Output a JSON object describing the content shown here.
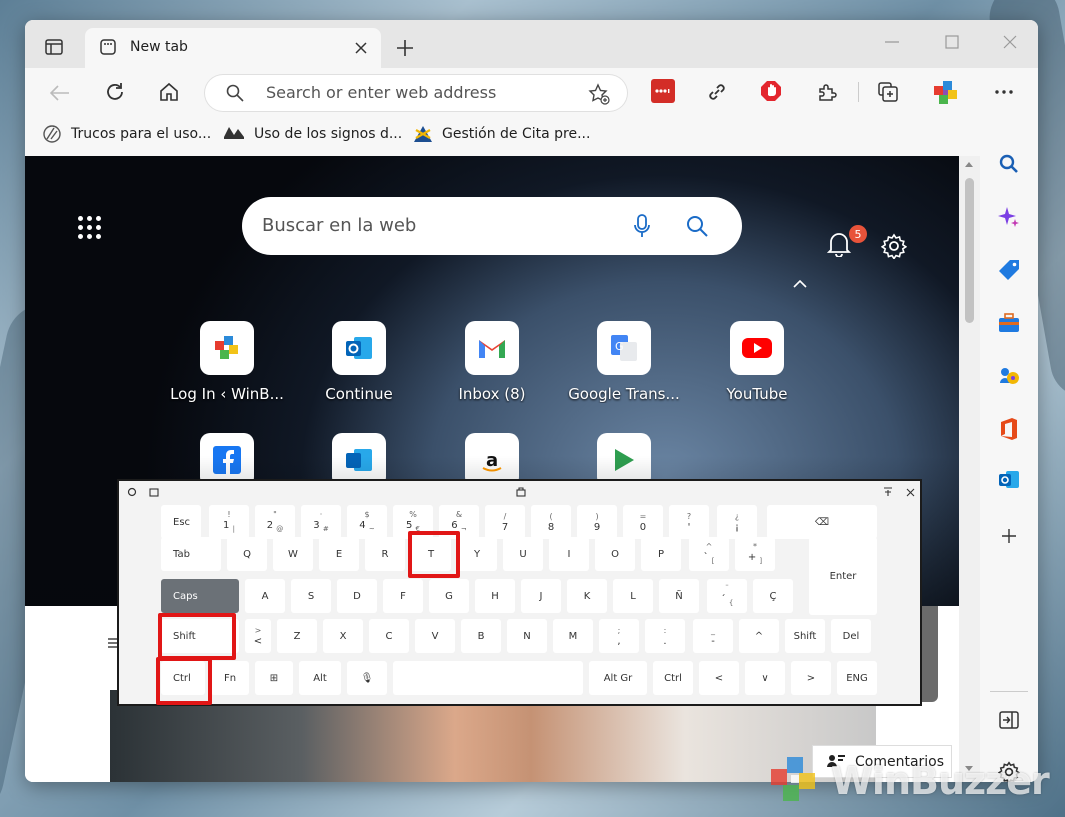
{
  "tab": {
    "title": "New tab"
  },
  "address_bar": {
    "placeholder": "Search or enter web address"
  },
  "favorites": [
    {
      "label": "Trucos para el uso..."
    },
    {
      "label": "Uso de los signos d..."
    },
    {
      "label": "Gestión de Cita pre..."
    }
  ],
  "newtab": {
    "search_placeholder": "Buscar en la web",
    "notification_count": "5",
    "tiles": [
      {
        "label": "Log In ‹ WinB..."
      },
      {
        "label": "Continue"
      },
      {
        "label": "Inbox (8)"
      },
      {
        "label": "Google Trans..."
      },
      {
        "label": "YouTube"
      }
    ],
    "feedback_label": "Comentarios"
  },
  "keyboard": {
    "rows": [
      [
        {
          "main": "Esc"
        },
        {
          "top": "!",
          "main": "1",
          "sub": "|"
        },
        {
          "top": "\"",
          "main": "2",
          "sub": "@"
        },
        {
          "top": "·",
          "main": "3",
          "sub": "#"
        },
        {
          "top": "$",
          "main": "4",
          "sub": "~"
        },
        {
          "top": "%",
          "main": "5",
          "sub": "€"
        },
        {
          "top": "&",
          "main": "6",
          "sub": "¬"
        },
        {
          "top": "/",
          "main": "7"
        },
        {
          "top": "(",
          "main": "8"
        },
        {
          "top": ")",
          "main": "9"
        },
        {
          "top": "=",
          "main": "0"
        },
        {
          "top": "?",
          "main": "'"
        },
        {
          "top": "¿",
          "main": "¡"
        }
      ],
      [
        {
          "main": "Tab"
        },
        {
          "main": "Q"
        },
        {
          "main": "W"
        },
        {
          "main": "E"
        },
        {
          "main": "R"
        },
        {
          "main": "T"
        },
        {
          "main": "Y"
        },
        {
          "main": "U"
        },
        {
          "main": "I"
        },
        {
          "main": "O"
        },
        {
          "main": "P"
        },
        {
          "top": "^",
          "main": "`",
          "sub": "["
        },
        {
          "top": "*",
          "main": "+",
          "sub": "]"
        }
      ],
      [
        {
          "main": "Caps"
        },
        {
          "main": "A"
        },
        {
          "main": "S"
        },
        {
          "main": "D"
        },
        {
          "main": "F"
        },
        {
          "main": "G"
        },
        {
          "main": "H"
        },
        {
          "main": "J"
        },
        {
          "main": "K"
        },
        {
          "main": "L"
        },
        {
          "main": "Ñ"
        },
        {
          "top": "¨",
          "main": "´",
          "sub": "{"
        },
        {
          "main": "Ç"
        }
      ],
      [
        {
          "main": "Shift"
        },
        {
          "top": ">",
          "main": "<"
        },
        {
          "main": "Z"
        },
        {
          "main": "X"
        },
        {
          "main": "C"
        },
        {
          "main": "V"
        },
        {
          "main": "B"
        },
        {
          "main": "N"
        },
        {
          "main": "M"
        },
        {
          "top": ";",
          "main": ","
        },
        {
          "top": ":",
          "main": "."
        },
        {
          "top": "_",
          "main": "-"
        },
        {
          "main": "^"
        },
        {
          "main": "Shift"
        },
        {
          "main": "Del"
        }
      ],
      [
        {
          "main": "Ctrl"
        },
        {
          "main": "Fn"
        },
        {
          "main": "⊞"
        },
        {
          "main": "Alt"
        },
        {
          "main": "🎙"
        },
        {
          "main": ""
        },
        {
          "main": "Alt Gr"
        },
        {
          "main": "Ctrl"
        },
        {
          "main": "<"
        },
        {
          "main": "∨"
        },
        {
          "main": ">"
        },
        {
          "main": "ENG"
        }
      ]
    ],
    "enter_label": "Enter"
  },
  "watermark": "WinBuzzer",
  "colors": {
    "highlight": "#e11616",
    "caps_key": "#6b7177"
  }
}
